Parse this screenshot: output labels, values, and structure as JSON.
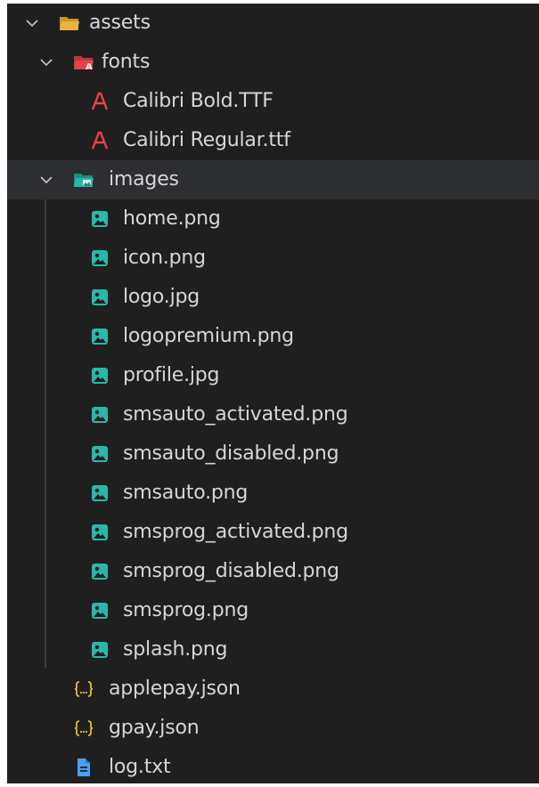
{
  "tree": {
    "assets": {
      "label": "assets"
    },
    "fonts": {
      "label": "fonts"
    },
    "font_files": [
      {
        "label": "Calibri Bold.TTF"
      },
      {
        "label": "Calibri Regular.ttf"
      }
    ],
    "images": {
      "label": "images"
    },
    "image_files": [
      {
        "label": "home.png"
      },
      {
        "label": "icon.png"
      },
      {
        "label": "logo.jpg"
      },
      {
        "label": "logopremium.png"
      },
      {
        "label": "profile.jpg"
      },
      {
        "label": "smsauto_activated.png"
      },
      {
        "label": "smsauto_disabled.png"
      },
      {
        "label": "smsauto.png"
      },
      {
        "label": "smsprog_activated.png"
      },
      {
        "label": "smsprog_disabled.png"
      },
      {
        "label": "smsprog.png"
      },
      {
        "label": "splash.png"
      }
    ],
    "root_files": [
      {
        "label": "applepay.json",
        "icon": "json-icon"
      },
      {
        "label": "gpay.json",
        "icon": "json-icon"
      },
      {
        "label": "log.txt",
        "icon": "text-file-icon"
      }
    ]
  },
  "colors": {
    "background": "#1f1f1f",
    "selected_row": "#2d2e31",
    "text": "#d6d6d6",
    "folder_yellow": "#e8b540",
    "font_red": "#e8424c",
    "image_teal": "#2bb7a7",
    "json_yellow": "#e5c023",
    "txt_blue": "#4d9ff2"
  }
}
